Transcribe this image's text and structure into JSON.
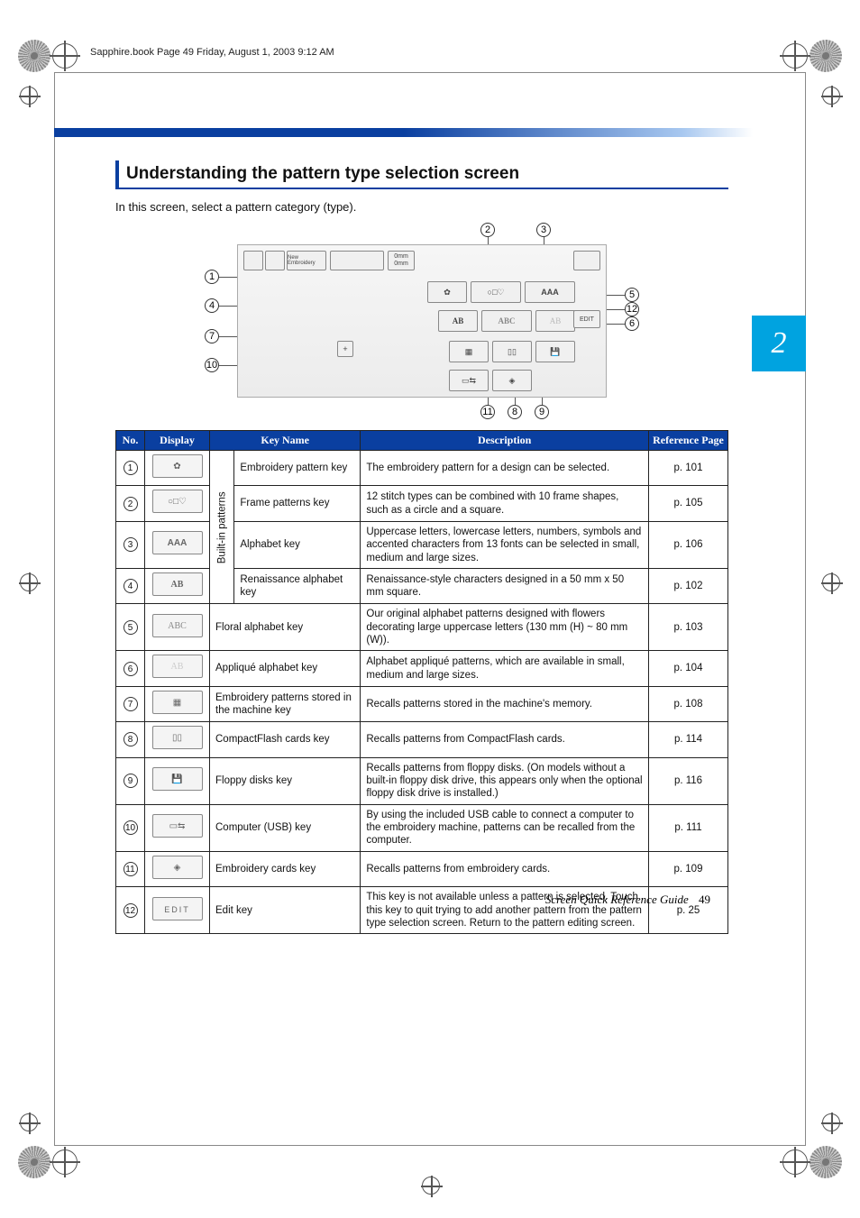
{
  "print_header": "Sapphire.book  Page 49  Friday, August 1, 2003  9:12 AM",
  "chapter_num": "2",
  "section_title": "Understanding the pattern type selection screen",
  "intro": "In this screen, select a pattern category (type).",
  "diagram": {
    "edit_label": "EDIT",
    "hdr_embroidery": "New Embroidery",
    "hdr_0mm": "0mm",
    "aaa": "AAA",
    "ab": "AB",
    "abc": "ABC",
    "ab2": "AB",
    "plus": "+",
    "callouts": [
      "1",
      "2",
      "3",
      "4",
      "5",
      "6",
      "7",
      "8",
      "9",
      "10",
      "11",
      "12"
    ]
  },
  "table": {
    "headers": {
      "no": "No.",
      "display": "Display",
      "keyname": "Key Name",
      "description": "Description",
      "refpage": "Reference Page"
    },
    "builtin_label": "Built-in patterns",
    "rows": [
      {
        "no": "1",
        "disp": "✿",
        "keyname": "Embroidery pattern key",
        "desc": "The embroidery pattern for a design can be selected.",
        "ref": "p. 101",
        "builtin": true
      },
      {
        "no": "2",
        "disp": "○□♡",
        "keyname": "Frame patterns key",
        "desc": "12 stitch types can be combined with 10 frame shapes, such as a circle and a square.",
        "ref": "p. 105",
        "builtin": true
      },
      {
        "no": "3",
        "disp": "AAA",
        "keyname": "Alphabet key",
        "desc": "Uppercase letters, lowercase letters, numbers, symbols and accented characters from 13 fonts can be selected in small, medium and large sizes.",
        "ref": "p. 106",
        "builtin": true
      },
      {
        "no": "4",
        "disp": "AB",
        "keyname": "Renaissance alphabet key",
        "desc": "Renaissance-style characters designed in a 50 mm x 50 mm square.",
        "ref": "p. 102",
        "builtin": true
      },
      {
        "no": "5",
        "disp": "ABC",
        "keyname": "Floral alphabet key",
        "desc": "Our original alphabet patterns designed with flowers decorating large uppercase letters (130 mm (H) ~ 80 mm (W)).",
        "ref": "p. 103",
        "builtin": false
      },
      {
        "no": "6",
        "disp": "AB",
        "keyname": "Appliqué alphabet key",
        "desc": "Alphabet appliqué patterns, which are available in small, medium and large sizes.",
        "ref": "p. 104",
        "builtin": false
      },
      {
        "no": "7",
        "disp": "▦",
        "keyname": "Embroidery patterns stored in the machine key",
        "desc": "Recalls patterns stored in the machine's memory.",
        "ref": "p. 108",
        "builtin": false
      },
      {
        "no": "8",
        "disp": "▯▯",
        "keyname": "CompactFlash cards key",
        "desc": "Recalls patterns from CompactFlash cards.",
        "ref": "p. 114",
        "builtin": false
      },
      {
        "no": "9",
        "disp": "💾",
        "keyname": "Floppy disks key",
        "desc": "Recalls patterns from floppy disks.\n(On models without a built-in floppy disk drive, this appears only when the optional floppy disk drive is installed.)",
        "ref": "p. 116",
        "builtin": false
      },
      {
        "no": "10",
        "disp": "▭⇆",
        "keyname": "Computer (USB) key",
        "desc": "By using the included USB cable to connect a computer to the embroidery machine, patterns can be recalled from the computer.",
        "ref": "p. 111",
        "builtin": false
      },
      {
        "no": "11",
        "disp": "◈",
        "keyname": "Embroidery cards key",
        "desc": "Recalls patterns from embroidery cards.",
        "ref": "p. 109",
        "builtin": false
      },
      {
        "no": "12",
        "disp": "EDIT",
        "keyname": "Edit key",
        "desc": "This key is not available unless a pattern is selected. Touch this key to quit trying to add another pattern from the pattern type selection screen. Return to the pattern editing screen.",
        "ref": "p. 25",
        "builtin": false
      }
    ]
  },
  "footer": {
    "title": "Screen Quick Reference Guide",
    "page": "49"
  }
}
